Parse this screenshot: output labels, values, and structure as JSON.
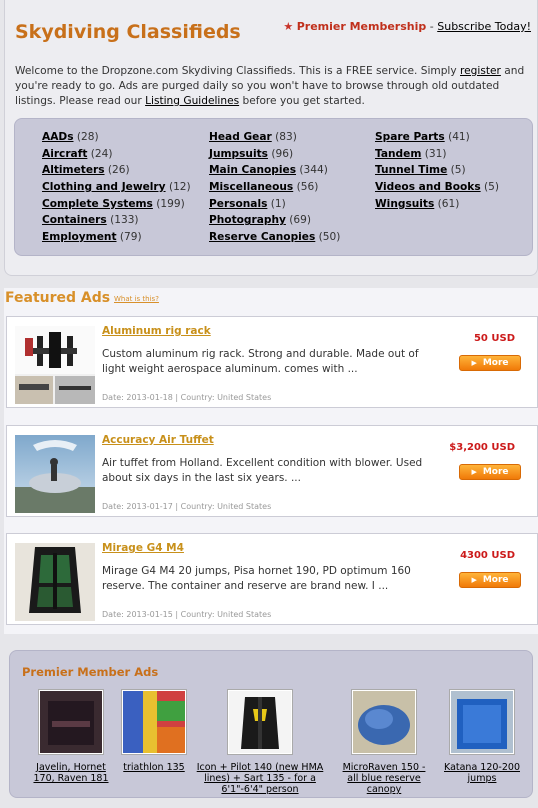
{
  "header": {
    "site_title": "Skydiving Classifieds",
    "premier_label": "Premier Membership",
    "separator": "-",
    "subscribe_label": "Subscribe Today!"
  },
  "intro": {
    "part1": "Welcome to the Dropzone.com Skydiving Classifieds. This is a FREE service. Simply ",
    "register_link": "register",
    "part2": " and you're ready to go. Ads are purged daily so you won't have to browse through old outdated listings. Please read our ",
    "guidelines_link": "Listing Guidelines",
    "part3": " before you get started."
  },
  "categories": {
    "columns": [
      [
        {
          "name": "AADs",
          "count": "(28)"
        },
        {
          "name": "Aircraft",
          "count": "(24)"
        },
        {
          "name": "Altimeters",
          "count": "(26)"
        },
        {
          "name": "Clothing and Jewelry",
          "count": "(12)"
        },
        {
          "name": "Complete Systems",
          "count": "(199)"
        },
        {
          "name": "Containers",
          "count": "(133)"
        },
        {
          "name": "Employment",
          "count": "(79)"
        }
      ],
      [
        {
          "name": "Head Gear",
          "count": "(83)"
        },
        {
          "name": "Jumpsuits",
          "count": "(96)"
        },
        {
          "name": "Main Canopies",
          "count": "(344)"
        },
        {
          "name": "Miscellaneous",
          "count": "(56)"
        },
        {
          "name": "Personals",
          "count": "(1)"
        },
        {
          "name": "Photography",
          "count": "(69)"
        },
        {
          "name": "Reserve Canopies",
          "count": "(50)"
        }
      ],
      [
        {
          "name": "Spare Parts",
          "count": "(41)"
        },
        {
          "name": "Tandem",
          "count": "(31)"
        },
        {
          "name": "Tunnel Time",
          "count": "(5)"
        },
        {
          "name": "Videos and Books",
          "count": "(5)"
        },
        {
          "name": "Wingsuits",
          "count": "(61)"
        }
      ]
    ]
  },
  "featured": {
    "title": "Featured Ads",
    "what_link": "What is this?",
    "more_label": "More",
    "ads": [
      {
        "title": "Aluminum rig rack",
        "desc": "Custom aluminum rig rack. Strong and durable. Made out of light weight aerospace aluminum. comes with ...",
        "meta": "Date: 2013-01-18 | Country: United States",
        "price": "50 USD"
      },
      {
        "title": "Accuracy Air Tuffet",
        "desc": "Air tuffet from Holland. Excellent condition with blower. Used about six days in the last six years. ...",
        "meta": "Date: 2013-01-17 | Country: United States",
        "price": "$3,200 USD"
      },
      {
        "title": "Mirage G4 M4",
        "desc": "Mirage G4 M4 20 jumps, Pisa hornet 190, PD optimum 160 reserve. The container and reserve are brand new. I ...",
        "meta": "Date: 2013-01-15 | Country: United States",
        "price": "4300 USD"
      }
    ]
  },
  "premier_ads": {
    "title": "Premier Member Ads",
    "items": [
      {
        "caption": "Javelin, Hornet 170, Raven 181"
      },
      {
        "caption": "triathlon 135"
      },
      {
        "caption": "Icon + Pilot 140 (new HMA lines) + Sart 135 - for a 6'1\"-6'4\" person"
      },
      {
        "caption": "MicroRaven 150 - all blue reserve canopy"
      },
      {
        "caption": "Katana 120-200 jumps"
      }
    ]
  },
  "colors": {
    "title_orange": "#c8701a",
    "price_red": "#cc1a1a",
    "panel_lavender": "#c8c8d8",
    "button_orange": "#f5900f"
  }
}
